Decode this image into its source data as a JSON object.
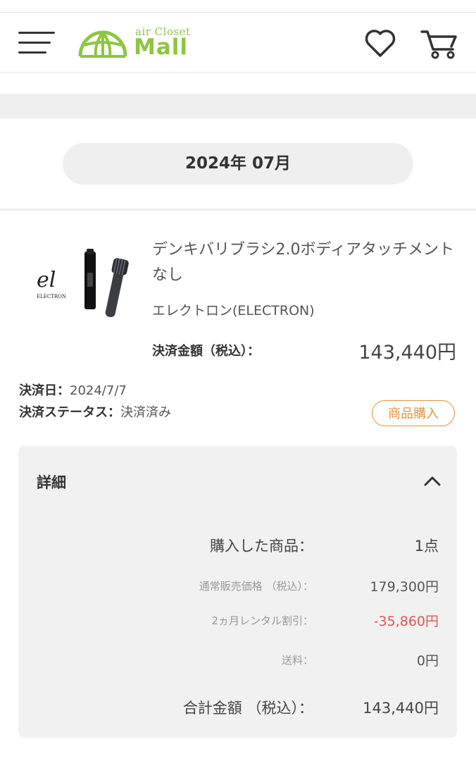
{
  "header": {
    "logo_small": "air Closet",
    "logo_big": "Mall"
  },
  "month_selector": "2024年 07月",
  "order": {
    "product_name": "デンキバリブラシ2.0ボディアタッチメントなし",
    "brand": "エレクトロン(ELECTRON)",
    "thumb_brand_text": "ELECTRON",
    "amount_label": "決済金額（税込）：",
    "amount_value": "143,440円",
    "pay_date_label": "決済日：",
    "pay_date_value": "2024/7/7",
    "pay_status_label": "決済ステータス：",
    "pay_status_value": "決済済み",
    "badge": "商品購入"
  },
  "detail": {
    "title": "詳細",
    "rows": [
      {
        "label": "購入した商品：",
        "value": "1点"
      },
      {
        "label": "通常販売価格 （税込）：",
        "value": "179,300円"
      },
      {
        "label": "2ヵ月レンタル割引：",
        "value": "-35,860円"
      },
      {
        "label": "送料：",
        "value": "0円"
      },
      {
        "label": "合計金額 （税込）：",
        "value": "143,440円"
      }
    ]
  },
  "colors": {
    "brand_green": "#8cc63f",
    "badge_orange": "#e8903c",
    "discount_red": "#e05555"
  },
  "icons": {
    "menu": "hamburger-menu-icon",
    "favorite": "heart-icon",
    "cart": "cart-icon",
    "collapse": "chevron-up-icon"
  }
}
